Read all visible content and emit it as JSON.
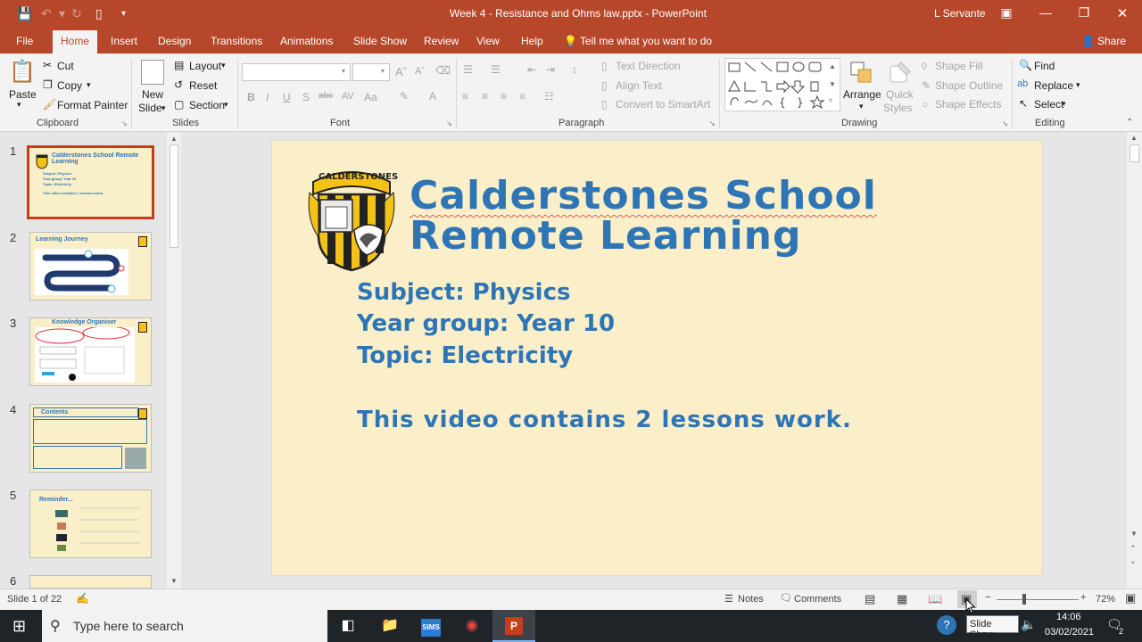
{
  "window": {
    "title": "Week 4 - Resistance and Ohms law.pptx  -  PowerPoint",
    "user": "L Servante"
  },
  "tabs": [
    {
      "label": "File",
      "active": false
    },
    {
      "label": "Home",
      "active": true
    },
    {
      "label": "Insert",
      "active": false
    },
    {
      "label": "Design",
      "active": false
    },
    {
      "label": "Transitions",
      "active": false
    },
    {
      "label": "Animations",
      "active": false
    },
    {
      "label": "Slide Show",
      "active": false
    },
    {
      "label": "Review",
      "active": false
    },
    {
      "label": "View",
      "active": false
    },
    {
      "label": "Help",
      "active": false
    }
  ],
  "tell_me": "Tell me what you want to do",
  "share": "Share",
  "ribbon": {
    "clipboard": {
      "paste": "Paste",
      "cut": "Cut",
      "copy": "Copy",
      "format_painter": "Format Painter",
      "group": "Clipboard"
    },
    "slides": {
      "new_slide_line1": "New",
      "new_slide_line2": "Slide",
      "layout": "Layout",
      "reset": "Reset",
      "section": "Section",
      "group": "Slides"
    },
    "font": {
      "bold": "B",
      "italic": "I",
      "underline": "U",
      "shadow": "S",
      "strike": "abc",
      "spacing": "AV",
      "case": "Aa",
      "group": "Font"
    },
    "paragraph": {
      "text_direction": "Text Direction",
      "align_text": "Align Text",
      "smartart": "Convert to SmartArt",
      "group": "Paragraph"
    },
    "drawing": {
      "arrange": "Arrange",
      "quick_styles_line1": "Quick",
      "quick_styles_line2": "Styles",
      "shape_fill": "Shape Fill",
      "shape_outline": "Shape Outline",
      "shape_effects": "Shape Effects",
      "group": "Drawing"
    },
    "editing": {
      "find": "Find",
      "replace": "Replace",
      "select": "Select",
      "group": "Editing"
    }
  },
  "thumbnails": [
    {
      "number": "1",
      "title": "Calderstones School Remote Learning",
      "lines": [
        "Subject: Physics",
        "Year group: Year 10",
        "Topic: Electricity",
        "This video contains 2 lessons work."
      ]
    },
    {
      "number": "2",
      "title": "Learning Journey"
    },
    {
      "number": "3",
      "title": "Knowledge Organiser"
    },
    {
      "number": "4",
      "title": "Contents"
    },
    {
      "number": "5",
      "title": "Reminder..."
    },
    {
      "number": "6",
      "title": ""
    }
  ],
  "slide": {
    "logo_text": "CALDERSTONES",
    "title_line1": "Calderstones School",
    "title_line2": "Remote Learning",
    "subject": "Subject: Physics",
    "year_group": "Year group: Year 10",
    "topic": "Topic: Electricity",
    "note": "This video contains 2 lessons work."
  },
  "status": {
    "slide_count": "Slide 1 of 22",
    "notes": "Notes",
    "comments": "Comments",
    "zoom": "72%",
    "tooltip": "Slide Show"
  },
  "taskbar": {
    "search_placeholder": "Type here to search",
    "sims": "SIMS",
    "time": "14:06",
    "date": "03/02/2021",
    "notif_count": "2"
  }
}
